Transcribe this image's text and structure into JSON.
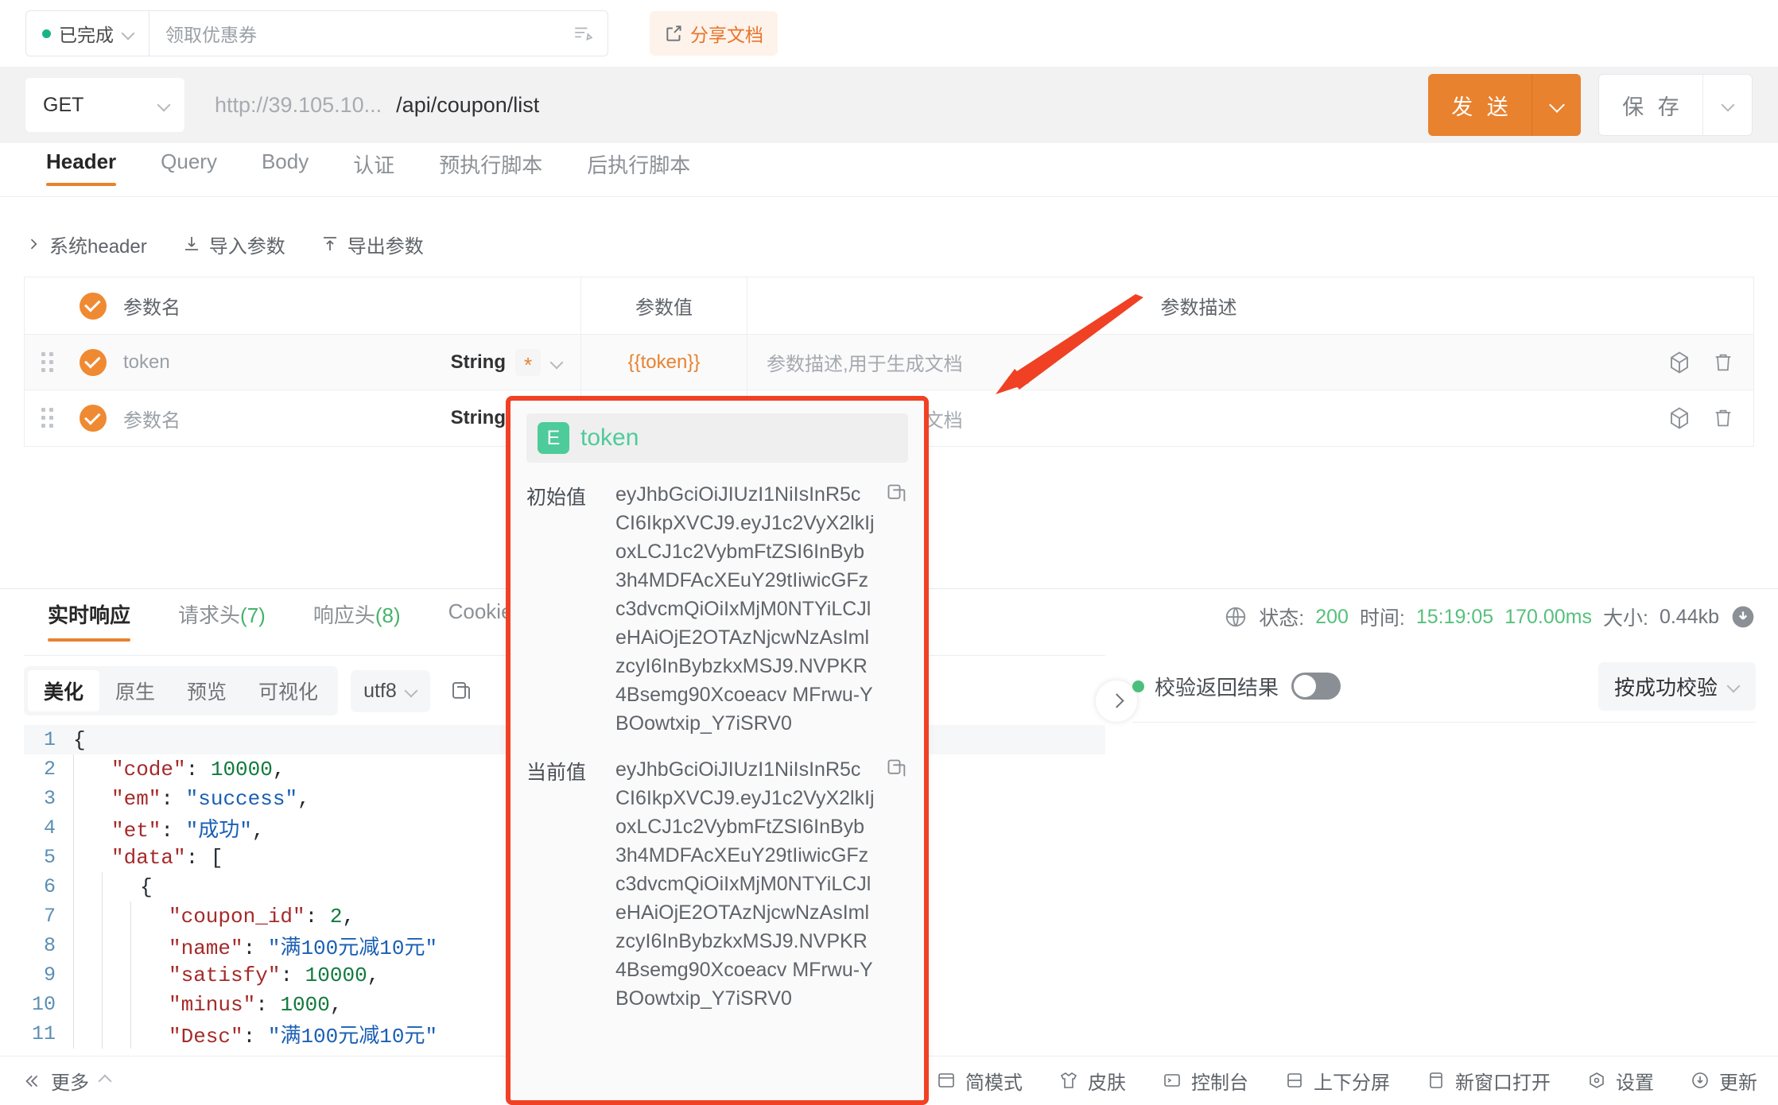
{
  "header": {
    "status_label": "已完成",
    "status_color": "#18b384",
    "api_name_placeholder": "领取优惠券",
    "api_name_value": "",
    "share_label": "分享文档",
    "doc_icon": "doc-edit-icon",
    "share_icon": "share-doc-icon"
  },
  "request": {
    "method": "GET",
    "url_host": "http://39.105.10...",
    "url_path": "/api/coupon/list",
    "send_label": "发 送",
    "save_label": "保 存"
  },
  "tabs": [
    {
      "label": "Header",
      "active": true
    },
    {
      "label": "Query",
      "active": false
    },
    {
      "label": "Body",
      "active": false
    },
    {
      "label": "认证",
      "active": false
    },
    {
      "label": "预执行脚本",
      "active": false
    },
    {
      "label": "后执行脚本",
      "active": false
    }
  ],
  "sub_actions": [
    {
      "label": "系统header",
      "icon": "chevron-right-icon"
    },
    {
      "label": "导入参数",
      "icon": "import-icon"
    },
    {
      "label": "导出参数",
      "icon": "export-icon"
    }
  ],
  "param_table": {
    "columns": [
      "参数名",
      "参数值",
      "参数描述"
    ],
    "rows": [
      {
        "checked": true,
        "name": "token",
        "type": "String",
        "required": "*",
        "value": "{{token}}",
        "desc": "参数描述,用于生成文档"
      },
      {
        "checked": true,
        "name": "参数名",
        "type": "String",
        "required": "*",
        "value": "",
        "desc": "参数描述,用于生成文档"
      }
    ],
    "row_ops": [
      "cube-icon",
      "trash-icon"
    ]
  },
  "token_popup": {
    "badge": "E",
    "title": "token",
    "initial_label": "初始值",
    "initial_value": "eyJhbGciOiJIUzI1NiIsInR5cCI6IkpXVCJ9.eyJ1c2VyX2lkIjoxLCJ1c2VybmFtZSI6InByb3h4MDFAcXEuY29tIiwicGFzc3dvcmQiOiIxMjM0NTYiLCJleHAiOjE2OTAzNjcwNzAsImlzcyI6InBybzkxMSJ9.NVPKR4Bsemg90Xcoeacv MFrwu-YBOowtxip_Y7iSRV0",
    "current_label": "当前值",
    "current_value": "eyJhbGciOiJIUzI1NiIsInR5cCI6IkpXVCJ9.eyJ1c2VyX2lkIjoxLCJ1c2VybmFtZSI6InByb3h4MDFAcXEuY29tIiwicGFzc3dvcmQiOiIxMjM0NTYiLCJleHAiOjE2OTAzNjcwNzAsImlzcyI6InBybzkxMSJ9.NVPKR4Bsemg90Xcoeacv MFrwu-YBOowtxip_Y7iSRV0",
    "copy_icon": "copy-icon"
  },
  "response": {
    "tabs": [
      {
        "label": "实时响应",
        "count": "",
        "active": true
      },
      {
        "label": "请求头",
        "count": "(7)",
        "active": false
      },
      {
        "label": "响应头",
        "count": "(8)",
        "active": false
      },
      {
        "label": "Cookie",
        "count": "",
        "active": false
      }
    ],
    "status_icon": "globe-icon",
    "status_label": "状态:",
    "status_code": "200",
    "time_label": "时间:",
    "time_value": "15:19:05",
    "duration": "170.00ms",
    "size_label": "大小:",
    "size_value": "0.44kb",
    "download_icon": "download-icon",
    "ok_color": "#56c07c"
  },
  "body_tools": {
    "segments": [
      {
        "label": "美化",
        "active": true
      },
      {
        "label": "原生",
        "active": false
      },
      {
        "label": "预览",
        "active": false
      },
      {
        "label": "可视化",
        "active": false
      }
    ],
    "encoding": "utf8",
    "copy_icon": "copy-icon"
  },
  "code": {
    "lines": [
      {
        "n": "1",
        "depth": 0,
        "tokens": [
          {
            "t": "pun",
            "v": "{"
          }
        ]
      },
      {
        "n": "2",
        "depth": 1,
        "tokens": [
          {
            "t": "key",
            "v": "\"code\""
          },
          {
            "t": "pun",
            "v": ": "
          },
          {
            "t": "num",
            "v": "10000"
          },
          {
            "t": "pun",
            "v": ","
          }
        ]
      },
      {
        "n": "3",
        "depth": 1,
        "tokens": [
          {
            "t": "key",
            "v": "\"em\""
          },
          {
            "t": "pun",
            "v": ": "
          },
          {
            "t": "str",
            "v": "\"success\""
          },
          {
            "t": "pun",
            "v": ","
          }
        ]
      },
      {
        "n": "4",
        "depth": 1,
        "tokens": [
          {
            "t": "key",
            "v": "\"et\""
          },
          {
            "t": "pun",
            "v": ": "
          },
          {
            "t": "str",
            "v": "\"成功\""
          },
          {
            "t": "pun",
            "v": ","
          }
        ]
      },
      {
        "n": "5",
        "depth": 1,
        "tokens": [
          {
            "t": "key",
            "v": "\"data\""
          },
          {
            "t": "pun",
            "v": ": ["
          }
        ]
      },
      {
        "n": "6",
        "depth": 2,
        "tokens": [
          {
            "t": "pun",
            "v": "{"
          }
        ]
      },
      {
        "n": "7",
        "depth": 3,
        "tokens": [
          {
            "t": "key",
            "v": "\"coupon_id\""
          },
          {
            "t": "pun",
            "v": ": "
          },
          {
            "t": "num",
            "v": "2"
          },
          {
            "t": "pun",
            "v": ","
          }
        ]
      },
      {
        "n": "8",
        "depth": 3,
        "tokens": [
          {
            "t": "key",
            "v": "\"name\""
          },
          {
            "t": "pun",
            "v": ": "
          },
          {
            "t": "str",
            "v": "\"满100元减10元\""
          }
        ]
      },
      {
        "n": "9",
        "depth": 3,
        "tokens": [
          {
            "t": "key",
            "v": "\"satisfy\""
          },
          {
            "t": "pun",
            "v": ": "
          },
          {
            "t": "num",
            "v": "10000"
          },
          {
            "t": "pun",
            "v": ","
          }
        ]
      },
      {
        "n": "10",
        "depth": 3,
        "tokens": [
          {
            "t": "key",
            "v": "\"minus\""
          },
          {
            "t": "pun",
            "v": ": "
          },
          {
            "t": "num",
            "v": "1000"
          },
          {
            "t": "pun",
            "v": ","
          }
        ]
      },
      {
        "n": "11",
        "depth": 3,
        "tokens": [
          {
            "t": "key",
            "v": "\"Desc\""
          },
          {
            "t": "pun",
            "v": ": "
          },
          {
            "t": "str",
            "v": "\"满100元减10元\""
          }
        ]
      }
    ]
  },
  "validation": {
    "label": "校验返回结果",
    "enabled": false,
    "mode": "按成功校验",
    "dot_color": "#4cbf7a"
  },
  "bottom_bar": {
    "more_label": "更多",
    "more_icon": "double-chevron-left-icon",
    "items": [
      {
        "label": "简模式",
        "icon": "simple-mode-icon"
      },
      {
        "label": "皮肤",
        "icon": "skin-icon"
      },
      {
        "label": "控制台",
        "icon": "console-icon"
      },
      {
        "label": "上下分屏",
        "icon": "split-screen-icon"
      },
      {
        "label": "新窗口打开",
        "icon": "new-window-icon"
      },
      {
        "label": "设置",
        "icon": "settings-icon"
      },
      {
        "label": "更新",
        "icon": "update-icon"
      }
    ]
  },
  "annotation": {
    "arrow_color": "#f04124",
    "box_color": "#f04124"
  }
}
